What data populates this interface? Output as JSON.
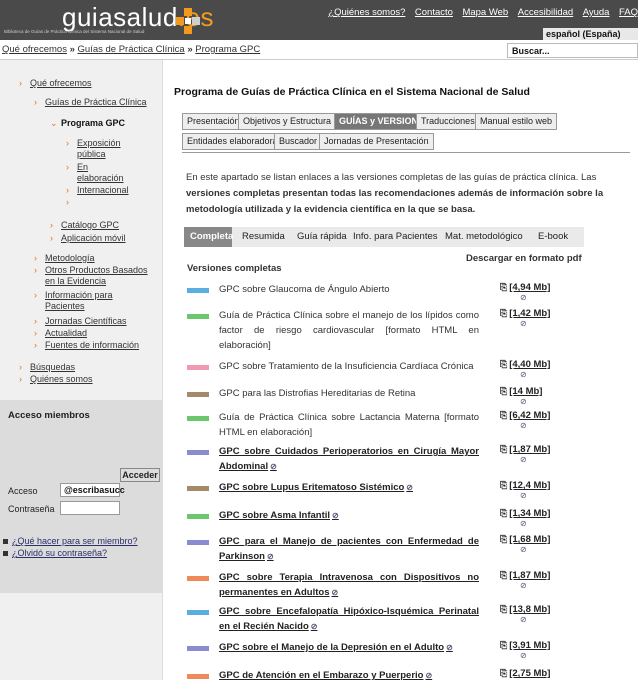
{
  "header": {
    "logo_text": "guiasalud",
    "logo_suffix": ".es",
    "logo_subtitle": "Biblioteca de Guías de Práctica Clínica del Sistema Nacional de Salud",
    "links": [
      "¿Quiénes somos?",
      "Contacto",
      "Mapa Web",
      "Accesibilidad",
      "Ayuda",
      "FAQ"
    ],
    "language": "español (España)"
  },
  "breadcrumb": {
    "items": [
      "Qué ofrecemos",
      "Guías de Práctica Clínica",
      "Programa GPC"
    ],
    "sep": "»"
  },
  "search": {
    "placeholder": "Buscar..."
  },
  "sidebar": {
    "items": [
      "Qué ofrecemos",
      "Guías de Práctica Clínica",
      "Programa GPC",
      "Exposición pública",
      "En elaboración",
      "Internacional",
      "",
      "Catálogo GPC",
      "Aplicación móvil",
      "Metodología",
      "Otros Productos Basados en la Evidencia",
      "Información para Pacientes",
      "Jornadas Científicas",
      "Actualidad",
      "Fuentes de información",
      "Búsquedas",
      "Quiénes somos"
    ],
    "members": {
      "title": "Acceso miembros",
      "access_label": "Acceso",
      "access_value": "@escribasucc",
      "password_label": "Contraseña",
      "button": "Acceder",
      "links": [
        "¿Qué hacer para ser miembro?",
        "¿Olvidó su contraseña?"
      ]
    }
  },
  "main": {
    "title": "Programa de Guías de Práctica Clínica en el Sistema Nacional de Salud",
    "tabs": [
      "Presentación",
      "Objetivos y Estructura",
      "GUÍAS y VERSIONES",
      "Traducciones",
      "Manual estilo web",
      "Entidades elaboradoras",
      "Buscador",
      "Jornadas de Presentación"
    ],
    "active_tab": "GUÍAS y VERSIONES",
    "intro_plain": "En este apartado se listan enlaces a las versiones completas de las guías de práctica clínica. Las",
    "intro_bold": "versiones completas presentan todas las recomendaciones además de información sobre la metodología utilizada y la evidencia científica en la que se basa.",
    "subtabs": [
      "Completa",
      "Resumida",
      "Guía rápida",
      "Info. para Pacientes",
      "Mat. metodológico",
      "E-book"
    ],
    "active_subtab": "Completa",
    "versions_title": "Versiones completas",
    "download_title": "Descargar en formato pdf",
    "guides": [
      {
        "title": "GPC sobre Glaucoma de Ángulo Abierto",
        "size": "[4,94 Mb]",
        "color": "#5aaee0",
        "link": false
      },
      {
        "title": "Guía de Práctica Clínica sobre el manejo de los lípidos como factor de riesgo cardiovascular [formato HTML en elaboración]",
        "size": "[1,42 Mb]",
        "color": "#6cc66c",
        "link": false
      },
      {
        "title": "GPC sobre Tratamiento de la Insuficiencia Cardíaca Crónica",
        "size": "[4,40 Mb]",
        "color": "#ef9ab0",
        "link": false
      },
      {
        "title": "GPC para las Distrofias Hereditarias de Retina",
        "size": "[14 Mb]",
        "color": "#a58a6a",
        "link": false
      },
      {
        "title": "Guía de Práctica Clínica sobre Lactancia Materna [formato HTML en elaboración]",
        "size": "[6,42 Mb]",
        "color": "#6cc66c",
        "link": false
      },
      {
        "title": "GPC sobre Cuidados Perioperatorios en Cirugía Mayor Abdominal",
        "size": "[1,87 Mb]",
        "color": "#8b8bd0",
        "link": true
      },
      {
        "title": "GPC sobre Lupus Eritematoso Sistémico",
        "size": "[12,4 Mb]",
        "color": "#a58a6a",
        "link": true
      },
      {
        "title": "GPC sobre Asma Infantil",
        "size": "[1,34 Mb]",
        "color": "#6cc66c",
        "link": true
      },
      {
        "title": "GPC para el Manejo de pacientes con Enfermedad de Parkinson",
        "size": "[1,68 Mb]",
        "color": "#8b8bd0",
        "link": true
      },
      {
        "title": "GPC sobre Terapia Intravenosa con Dispositivos no permanentes en Adultos",
        "size": "[1,87 Mb]",
        "color": "#f08a5a",
        "link": true
      },
      {
        "title": "GPC sobre Encefalopatía Hipóxico-Isquémica Perinatal en el Recién Nacido",
        "size": "[13,8 Mb]",
        "color": "#5aaee0",
        "link": true
      },
      {
        "title": "GPC sobre el Manejo de la Depresión en el Adulto",
        "size": "[3,91 Mb]",
        "color": "#8b8bd0",
        "link": true
      },
      {
        "title": "GPC de Atención en el Embarazo y Puerperio",
        "size": "[2,75 Mb]",
        "color": "#f08a5a",
        "link": true
      }
    ]
  }
}
